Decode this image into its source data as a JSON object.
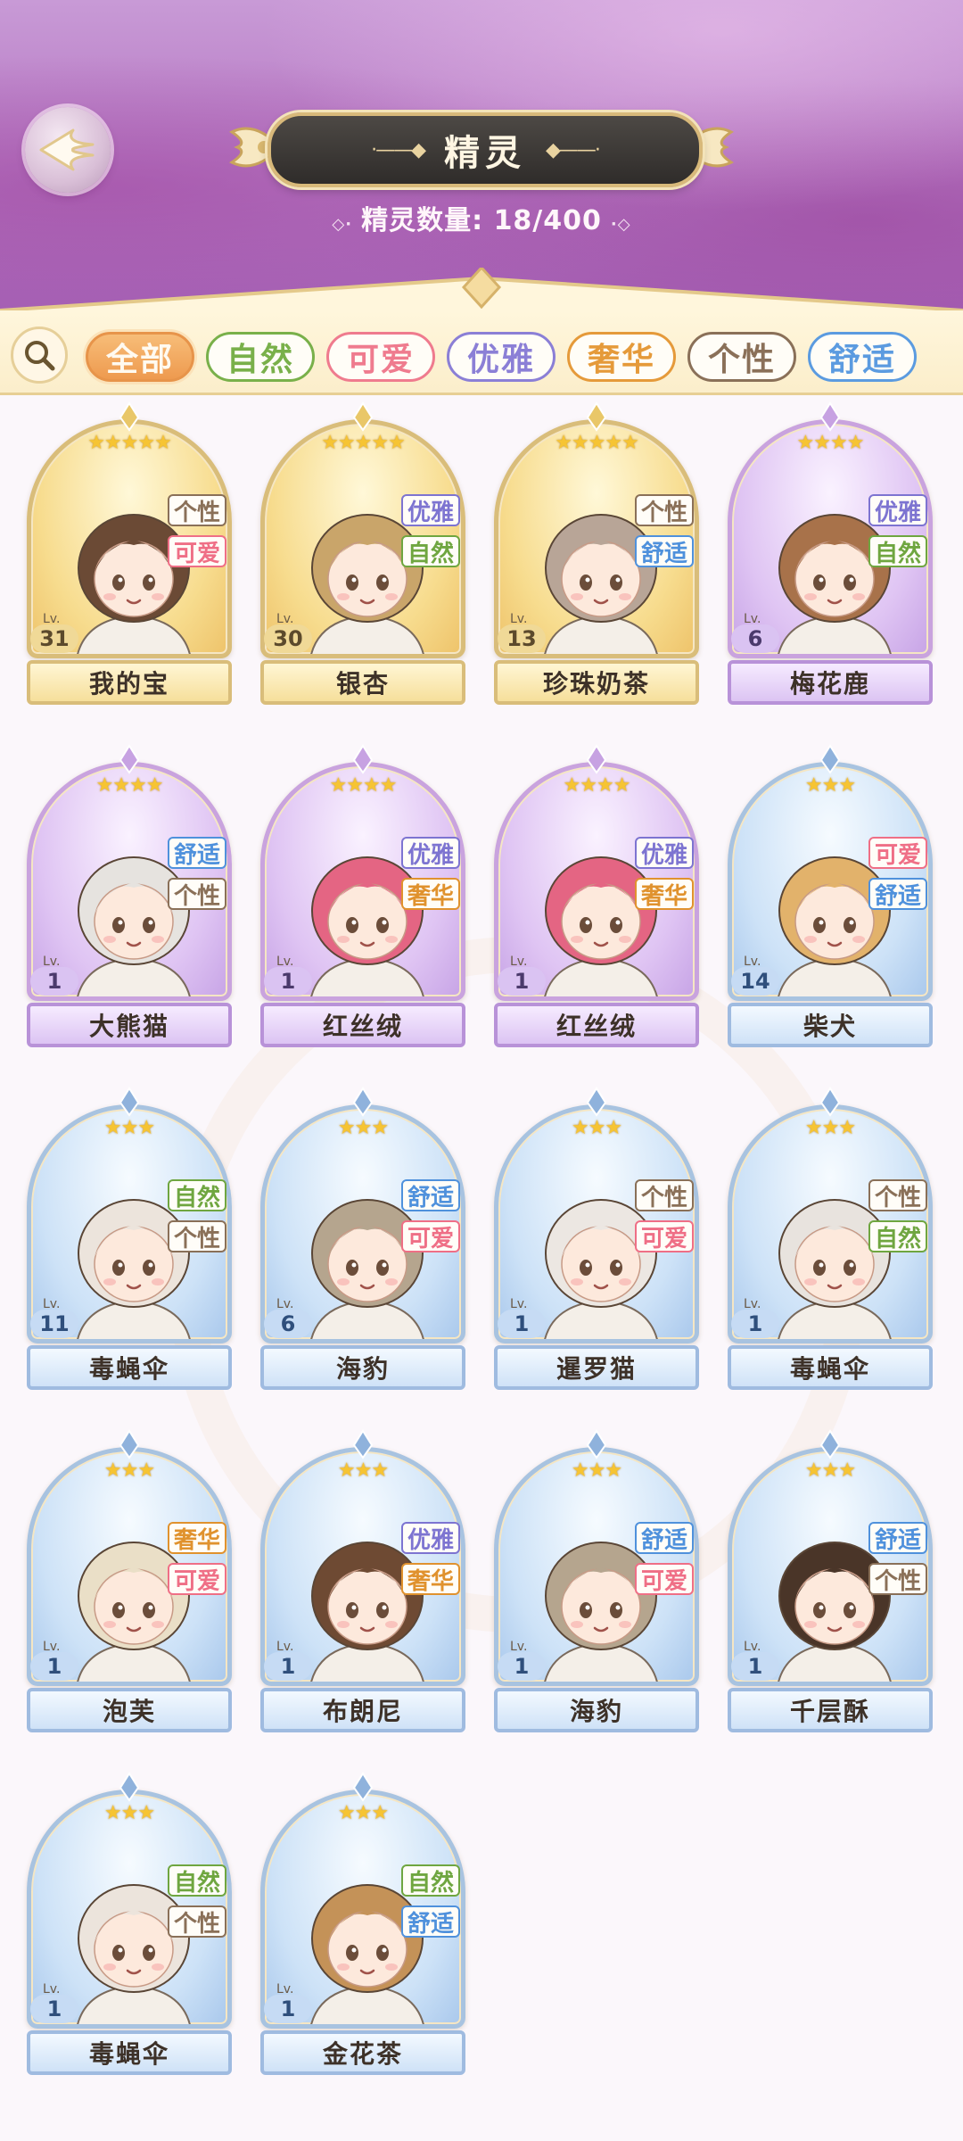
{
  "header": {
    "title": "精灵",
    "count_label": "精灵数量",
    "count_value": "18/400"
  },
  "filters": [
    {
      "label": "全部",
      "color": "#ee9a4f",
      "active": true
    },
    {
      "label": "自然",
      "color": "#79b04a",
      "active": false
    },
    {
      "label": "可爱",
      "color": "#ef7b8e",
      "active": false
    },
    {
      "label": "优雅",
      "color": "#8b7fd6",
      "active": false
    },
    {
      "label": "奢华",
      "color": "#e59a3a",
      "active": false
    },
    {
      "label": "个性",
      "color": "#8a7058",
      "active": false
    },
    {
      "label": "舒适",
      "color": "#5b9be0",
      "active": false
    }
  ],
  "tag_colors": {
    "个性": "#8a7058",
    "可爱": "#ef6f86",
    "优雅": "#7d74d1",
    "自然": "#6fa640",
    "舒适": "#4f91dc",
    "奢华": "#e0922e"
  },
  "spirits": [
    {
      "name": "我的宝",
      "level": "31",
      "stars": 5,
      "rarity": "gold",
      "tags": [
        "个性",
        "可爱"
      ],
      "hair": "#6b4a35"
    },
    {
      "name": "银杏",
      "level": "30",
      "stars": 5,
      "rarity": "gold",
      "tags": [
        "优雅",
        "自然"
      ],
      "hair": "#c9a56a"
    },
    {
      "name": "珍珠奶茶",
      "level": "13",
      "stars": 5,
      "rarity": "gold",
      "tags": [
        "个性",
        "舒适"
      ],
      "hair": "#b8a597"
    },
    {
      "name": "梅花鹿",
      "level": "6",
      "stars": 4,
      "rarity": "purple",
      "tags": [
        "优雅",
        "自然"
      ],
      "hair": "#a8724a"
    },
    {
      "name": "大熊猫",
      "level": "1",
      "stars": 4,
      "rarity": "purple",
      "tags": [
        "舒适",
        "个性"
      ],
      "hair": "#e6e3df"
    },
    {
      "name": "红丝绒",
      "level": "1",
      "stars": 4,
      "rarity": "purple",
      "tags": [
        "优雅",
        "奢华"
      ],
      "hair": "#e46583"
    },
    {
      "name": "红丝绒",
      "level": "1",
      "stars": 4,
      "rarity": "purple",
      "tags": [
        "优雅",
        "奢华"
      ],
      "hair": "#e46583"
    },
    {
      "name": "柴犬",
      "level": "14",
      "stars": 3,
      "rarity": "blue",
      "tags": [
        "可爱",
        "舒适"
      ],
      "hair": "#e2b26b"
    },
    {
      "name": "毒蝇伞",
      "level": "11",
      "stars": 3,
      "rarity": "blue",
      "tags": [
        "自然",
        "个性"
      ],
      "hair": "#ece4dc"
    },
    {
      "name": "海豹",
      "level": "6",
      "stars": 3,
      "rarity": "blue",
      "tags": [
        "舒适",
        "可爱"
      ],
      "hair": "#b5a58e"
    },
    {
      "name": "暹罗猫",
      "level": "1",
      "stars": 3,
      "rarity": "blue",
      "tags": [
        "个性",
        "可爱"
      ],
      "hair": "#ece7e2"
    },
    {
      "name": "毒蝇伞",
      "level": "1",
      "stars": 3,
      "rarity": "blue",
      "tags": [
        "个性",
        "自然"
      ],
      "hair": "#e8e3de"
    },
    {
      "name": "泡芙",
      "level": "1",
      "stars": 3,
      "rarity": "blue",
      "tags": [
        "奢华",
        "可爱"
      ],
      "hair": "#eadfc7"
    },
    {
      "name": "布朗尼",
      "level": "1",
      "stars": 3,
      "rarity": "blue",
      "tags": [
        "优雅",
        "奢华"
      ],
      "hair": "#6e4a33"
    },
    {
      "name": "海豹",
      "level": "1",
      "stars": 3,
      "rarity": "blue",
      "tags": [
        "舒适",
        "可爱"
      ],
      "hair": "#b5a58e"
    },
    {
      "name": "千层酥",
      "level": "1",
      "stars": 3,
      "rarity": "blue",
      "tags": [
        "舒适",
        "个性"
      ],
      "hair": "#4a3528"
    },
    {
      "name": "毒蝇伞",
      "level": "1",
      "stars": 3,
      "rarity": "blue",
      "tags": [
        "自然",
        "个性"
      ],
      "hair": "#ece4dc"
    },
    {
      "name": "金花茶",
      "level": "1",
      "stars": 3,
      "rarity": "blue",
      "tags": [
        "自然",
        "舒适"
      ],
      "hair": "#c49258"
    }
  ]
}
